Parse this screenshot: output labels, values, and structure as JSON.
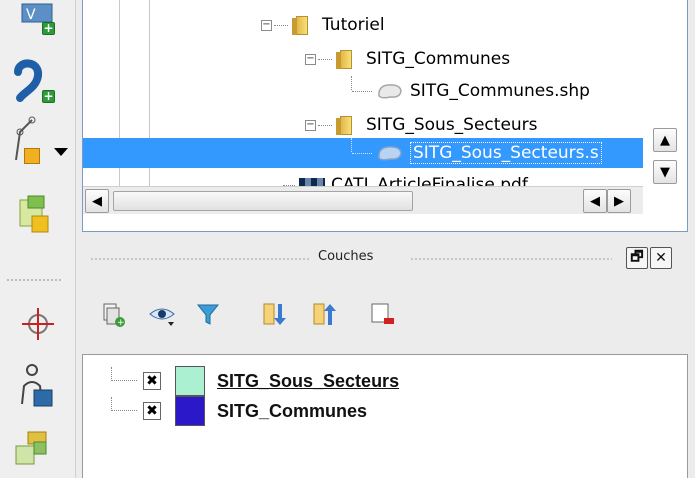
{
  "browser": {
    "items": [
      {
        "label": "Tutoriel"
      },
      {
        "label": "SITG_Communes"
      },
      {
        "label": "SITG_Communes.shp"
      },
      {
        "label": "SITG_Sous_Secteurs"
      },
      {
        "label": "SITG_Sous_Secteurs.s"
      },
      {
        "label": "CATI_ArticleFinalise.pdf"
      }
    ],
    "expand_symbol": "−",
    "selected_index": 4
  },
  "layers_panel": {
    "title": "Couches",
    "restore_symbol": "🗗",
    "close_symbol": "✕",
    "layers": [
      {
        "name": "SITG_Sous_Secteurs",
        "color": "#aaf0d1",
        "checked_symbol": "✖"
      },
      {
        "name": "SITG_Communes",
        "color": "#2b18c8",
        "checked_symbol": "✖"
      }
    ]
  },
  "scroll": {
    "up": "▲",
    "down": "▼",
    "left": "◀",
    "right": "▶"
  },
  "icons": {
    "left_toolbar": [
      "add-vector-layer-icon",
      "add-text-layer-icon",
      "new-shapefile-icon",
      "add-virtual-layer-icon",
      "crosshair-icon",
      "identify-icon",
      "add-wms-icon"
    ],
    "layers_toolbar": [
      "add-group-icon",
      "visibility-icon",
      "filter-icon",
      "expand-all-icon",
      "collapse-all-icon",
      "remove-layer-icon"
    ]
  },
  "colors": {
    "selection": "#3399ff",
    "border_accent": "#7a9cc4"
  }
}
